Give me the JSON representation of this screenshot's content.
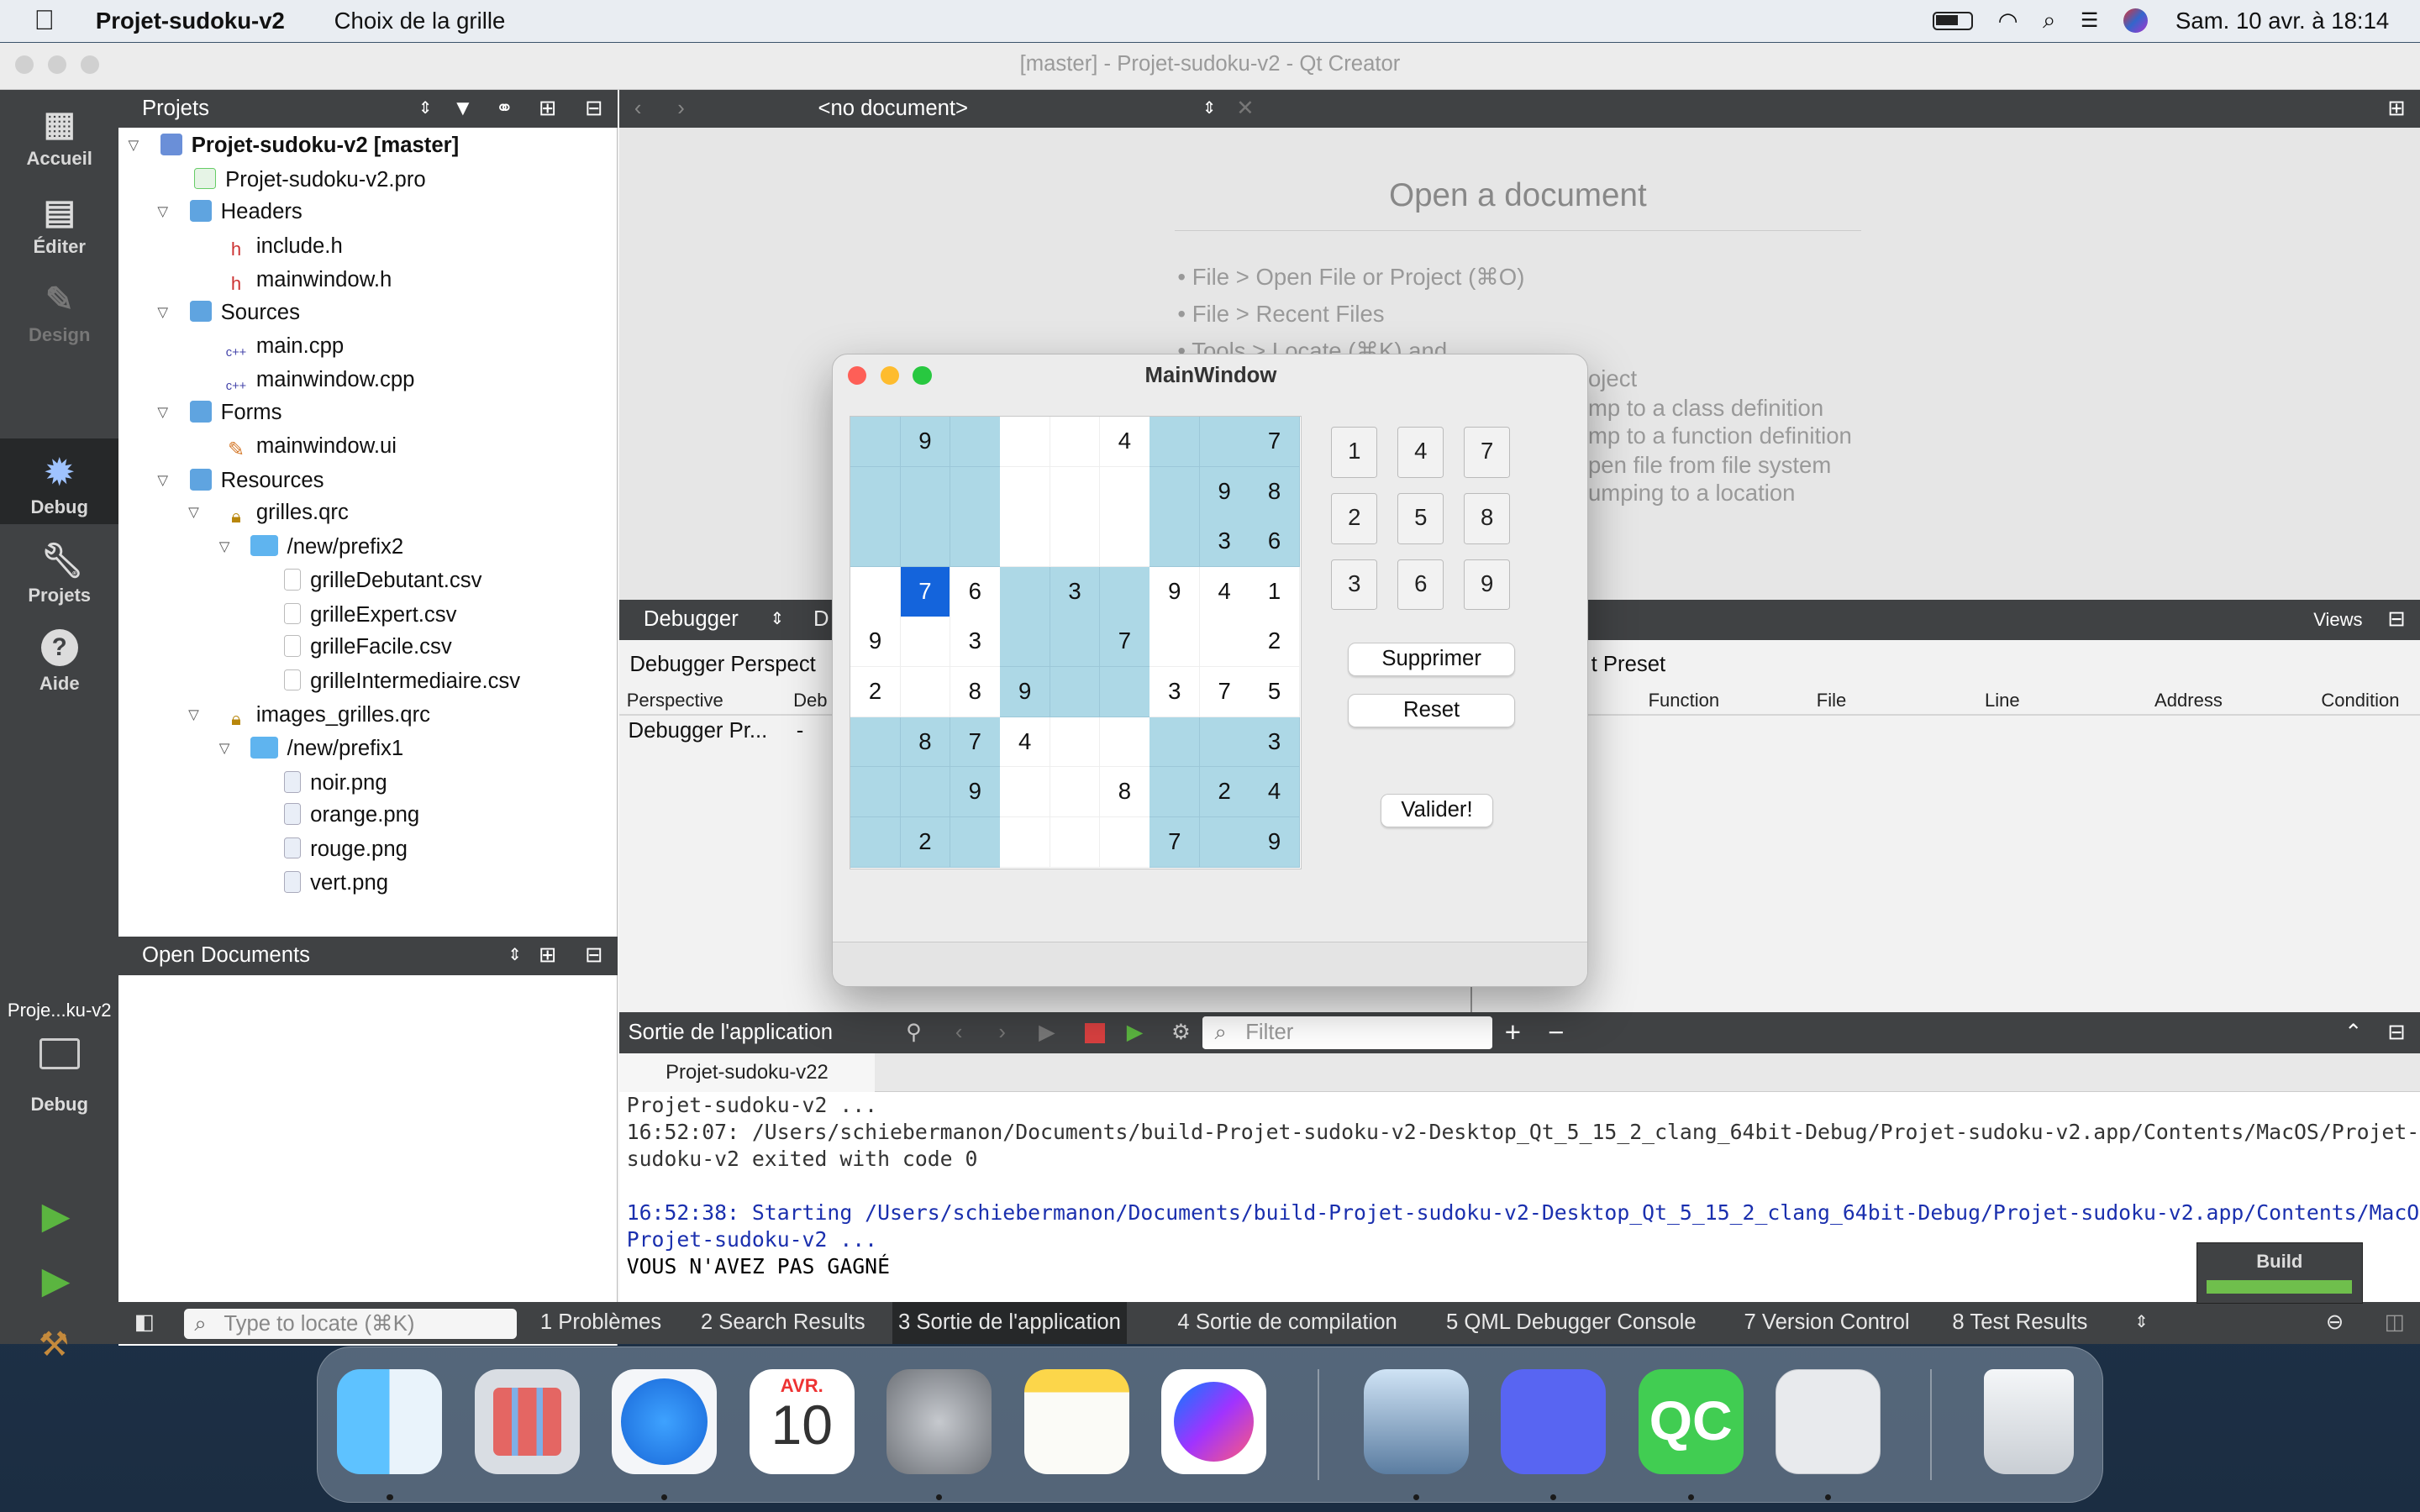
{
  "menubar": {
    "app": "Projet-sudoku-v2",
    "menu_item": "Choix de la grille",
    "datetime": "Sam. 10 avr. à  18:14"
  },
  "window": {
    "title": "[master] - Projet-sudoku-v2 - Qt Creator"
  },
  "modes": [
    {
      "label": "Accueil",
      "icon": "grid-icon"
    },
    {
      "label": "Éditer",
      "icon": "document-icon"
    },
    {
      "label": "Design",
      "icon": "pencil-icon"
    },
    {
      "label": "Debug",
      "icon": "bug-icon"
    },
    {
      "label": "Projets",
      "icon": "wrench-icon"
    },
    {
      "label": "Aide",
      "icon": "help-icon"
    }
  ],
  "target": {
    "project": "Proje...ku-v2",
    "mode": "Debug"
  },
  "projects": {
    "header": "Projets",
    "tree": [
      "Projet-sudoku-v2 [master]",
      "Projet-sudoku-v2.pro",
      "Headers",
      "include.h",
      "mainwindow.h",
      "Sources",
      "main.cpp",
      "mainwindow.cpp",
      "Forms",
      "mainwindow.ui",
      "Resources",
      "grilles.qrc",
      "/new/prefix2",
      "grilleDebutant.csv",
      "grilleExpert.csv",
      "grilleFacile.csv",
      "grilleIntermediaire.csv",
      "images_grilles.qrc",
      "/new/prefix1",
      "noir.png",
      "orange.png",
      "rouge.png",
      "vert.png"
    ]
  },
  "open_documents": {
    "header": "Open Documents"
  },
  "editor": {
    "document_combo": "<no document>",
    "heading": "Open a document",
    "tips": [
      "• File > Open File or Project (⌘O)",
      "• File > Recent Files",
      "• Tools > Locate (⌘K) and",
      "oject",
      "mp to a class definition",
      "mp to a function definition",
      "pen file from file system",
      "umping to a location"
    ]
  },
  "debugger": {
    "combo": "Debugger",
    "combo2": "D",
    "views": "Views",
    "perspective_title": "Debugger Perspect",
    "preset": "t Preset",
    "left_cols": [
      "Perspective",
      "Deb"
    ],
    "left_row": [
      "Debugger Pr...",
      "-"
    ],
    "right_cols": [
      "Function",
      "File",
      "Line",
      "Address",
      "Condition"
    ]
  },
  "output": {
    "title": "Sortie de l'application",
    "filter_placeholder": "Filter",
    "tab": "Projet-sudoku-v22",
    "lines": [
      "Projet-sudoku-v2 ...",
      "16:52:07: /Users/schiebermanon/Documents/build-Projet-sudoku-v2-Desktop_Qt_5_15_2_clang_64bit-Debug/Projet-sudoku-v2.app/Contents/MacOS/Projet-",
      "sudoku-v2 exited with code 0",
      "",
      "16:52:38: Starting /Users/schiebermanon/Documents/build-Projet-sudoku-v2-Desktop_Qt_5_15_2_clang_64bit-Debug/Projet-sudoku-v2.app/Contents/MacOS/",
      "Projet-sudoku-v2 ...",
      "VOUS N'AVEZ PAS GAGNÉ"
    ]
  },
  "statusbar": {
    "locate_placeholder": "Type to locate (⌘K)",
    "panes": [
      "1  Problèmes",
      "2  Search Results",
      "3  Sortie de l'application",
      "4  Sortie de compilation",
      "5  QML Debugger Console",
      "7  Version Control",
      "8  Test Results"
    ]
  },
  "build": {
    "label": "Build",
    "progress": 1.0
  },
  "sudoku": {
    "title": "MainWindow",
    "grid": [
      [
        "",
        "9",
        "",
        "",
        "",
        "4",
        "",
        "",
        "7"
      ],
      [
        "",
        "",
        "",
        "",
        "",
        "",
        "",
        "9",
        "8"
      ],
      [
        "",
        "",
        "",
        "",
        "",
        "",
        "",
        "3",
        "6"
      ],
      [
        "",
        "7",
        "6",
        "",
        "3",
        "",
        "9",
        "4",
        "1"
      ],
      [
        "9",
        "",
        "3",
        "",
        "",
        "7",
        "",
        "",
        "2"
      ],
      [
        "2",
        "",
        "8",
        "9",
        "",
        "",
        "3",
        "7",
        "5"
      ],
      [
        "",
        "8",
        "7",
        "4",
        "",
        "",
        "",
        "",
        "3"
      ],
      [
        "",
        "",
        "9",
        "",
        "",
        "8",
        "",
        "2",
        "4"
      ],
      [
        "",
        "2",
        "",
        "",
        "",
        "",
        "7",
        "",
        "9"
      ]
    ],
    "selected_cell": [
      3,
      1
    ],
    "colors": {
      "shaded": "#add8e6",
      "selected": "#1464dc",
      "plain": "#ffffff"
    },
    "numpad": [
      "1",
      "4",
      "7",
      "2",
      "5",
      "8",
      "3",
      "6",
      "9"
    ],
    "buttons": {
      "delete": "Supprimer",
      "reset": "Reset",
      "validate": "Valider!"
    }
  },
  "dock": [
    "Finder",
    "Launchpad",
    "Safari",
    "Calendar",
    "System Preferences",
    "Notes",
    "Messenger",
    "Preview",
    "Discord",
    "Qt Creator",
    "Sudoku",
    "Trash"
  ],
  "calendar": {
    "month": "AVR.",
    "day": "10"
  }
}
